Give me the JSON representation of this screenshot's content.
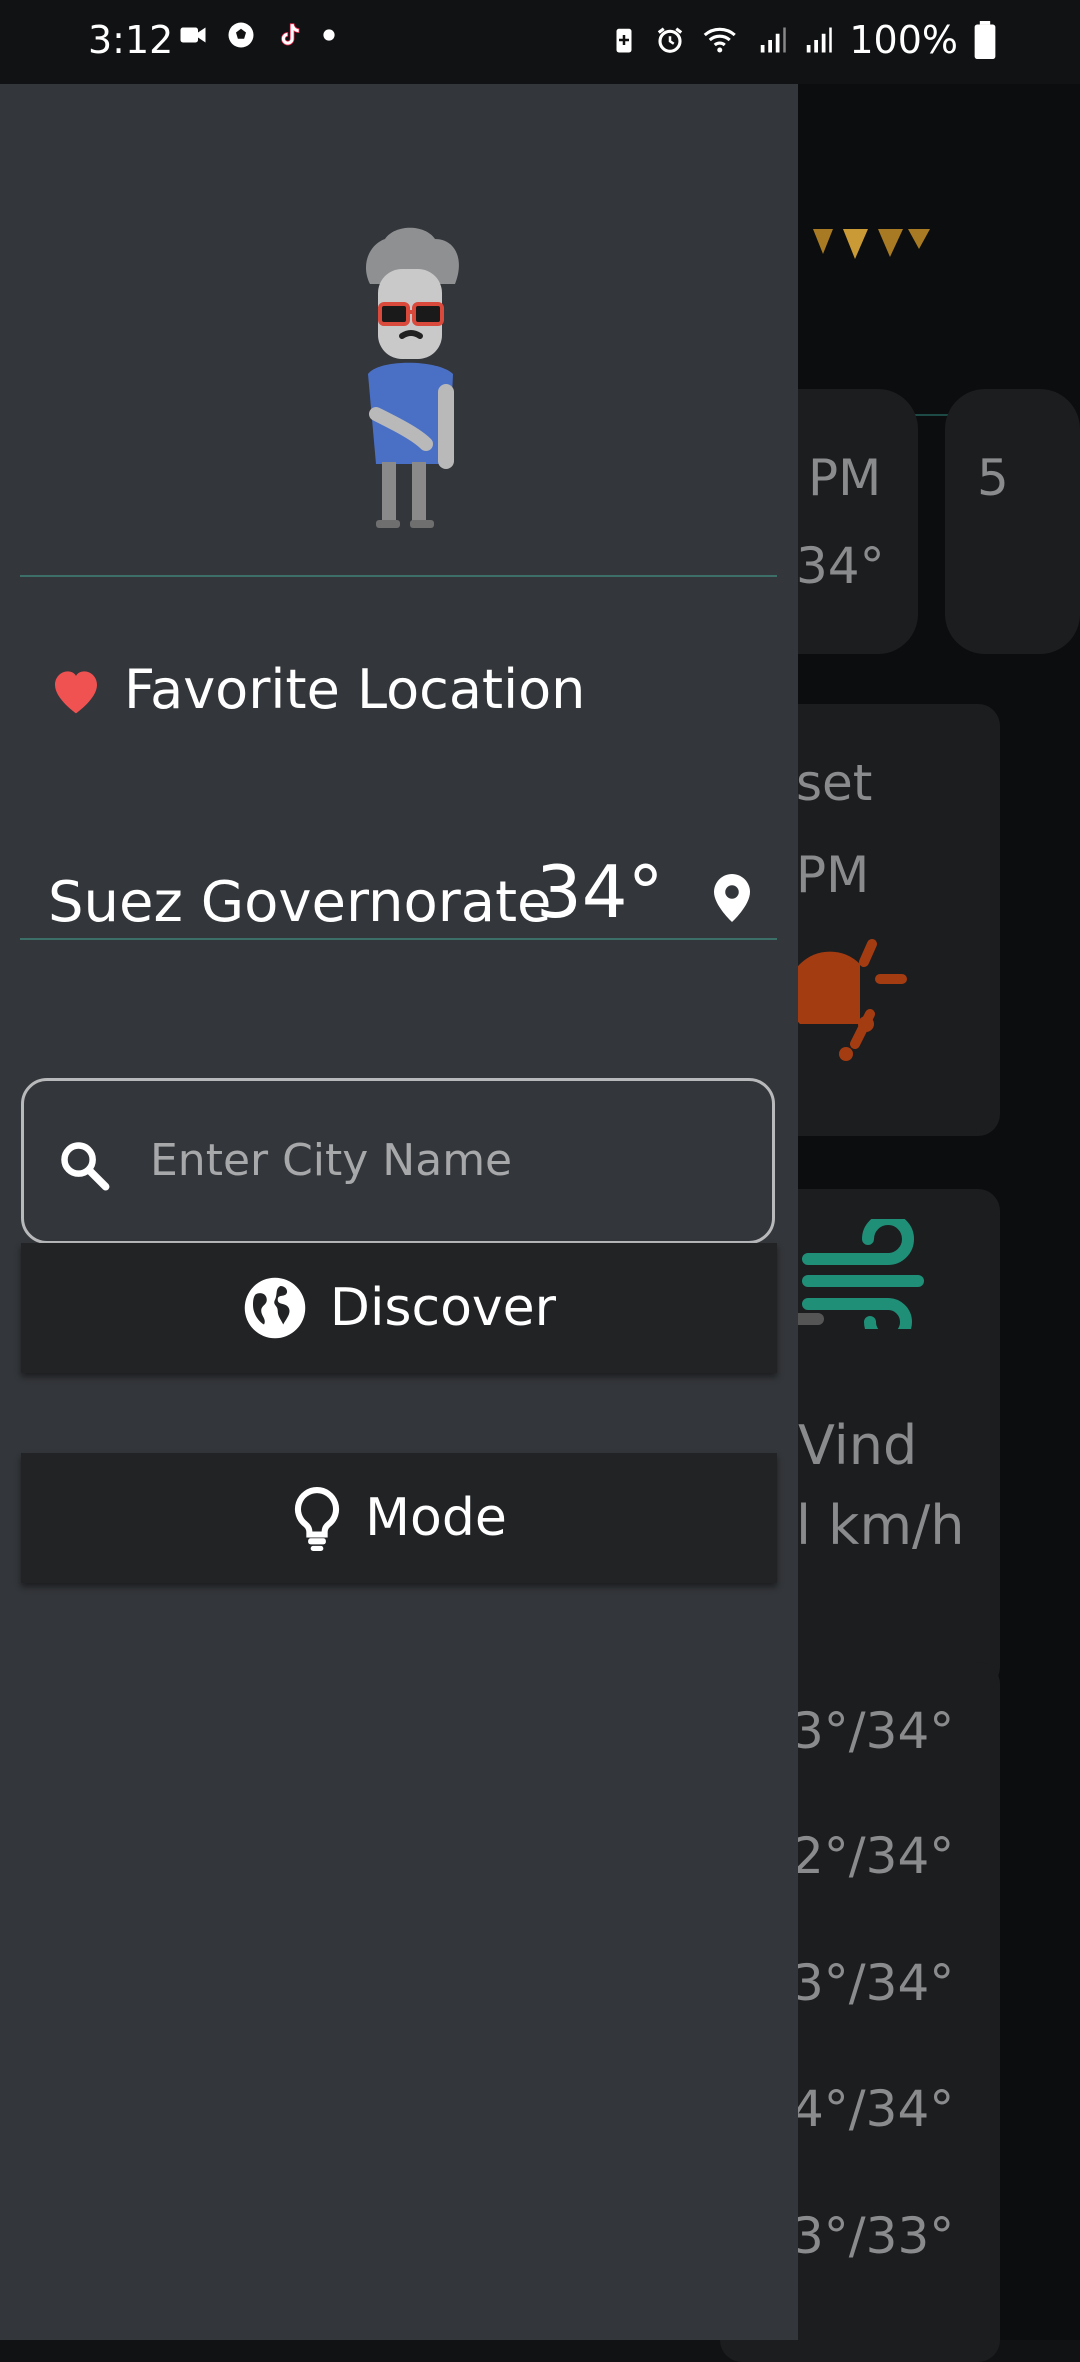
{
  "status_bar": {
    "time": "3:12",
    "battery": "100%",
    "left_icons": [
      "video-camera-icon",
      "soccer-ball-icon",
      "tiktok-icon",
      "dot-icon"
    ],
    "right_icons": [
      "battery-saver-icon",
      "alarm-icon",
      "wifi-icon",
      "signal-icon",
      "signal-icon",
      "battery-icon"
    ]
  },
  "drawer": {
    "favorite_label": "Favorite Location",
    "favorite_city": "Suez Governorate",
    "favorite_temp": "34°",
    "search_placeholder": "Enter City Name",
    "discover_label": "Discover",
    "mode_label": "Mode"
  },
  "background": {
    "hour_card_1_time": "PM",
    "hour_card_1_temp": "34°",
    "hour_card_2_time": "5",
    "sunset_label": "set",
    "sunset_time": "PM",
    "wind_label": "Vind",
    "wind_value": "l km/h",
    "daily_ranges": [
      "3°/34°",
      "2°/34°",
      "3°/34°",
      "4°/34°",
      "3°/33°"
    ]
  },
  "colors": {
    "drawer_bg": "#33363a",
    "button_bg": "#222325",
    "divider": "#3d6f69",
    "heart": "#f05252",
    "wind_icon": "#1f8f78"
  }
}
